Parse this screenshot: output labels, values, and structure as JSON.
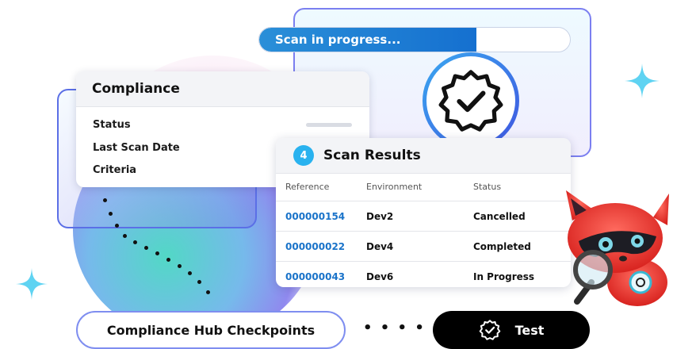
{
  "progress": {
    "label": "Scan in progress...",
    "percent": 70
  },
  "compliance": {
    "title": "Compliance",
    "rows": [
      "Status",
      "Last Scan Date",
      "Criteria"
    ]
  },
  "scan_results": {
    "count": "4",
    "title": "Scan Results",
    "columns": [
      "Reference",
      "Environment",
      "Status"
    ],
    "rows": [
      {
        "reference": "000000154",
        "environment": "Dev2",
        "status": "Cancelled"
      },
      {
        "reference": "000000022",
        "environment": "Dev4",
        "status": "Completed"
      },
      {
        "reference": "000000043",
        "environment": "Dev6",
        "status": "In Progress"
      }
    ]
  },
  "buttons": {
    "hub_label": "Compliance Hub Checkpoints",
    "connector": "• • • •",
    "test_label": "Test"
  },
  "icons": [
    "verified-badge-icon",
    "verified-check-icon",
    "sparkle-icon",
    "fox-mascot"
  ],
  "colors": {
    "accent": "#1570d0",
    "link": "#1a73c9",
    "badge": "#29b2ef"
  }
}
